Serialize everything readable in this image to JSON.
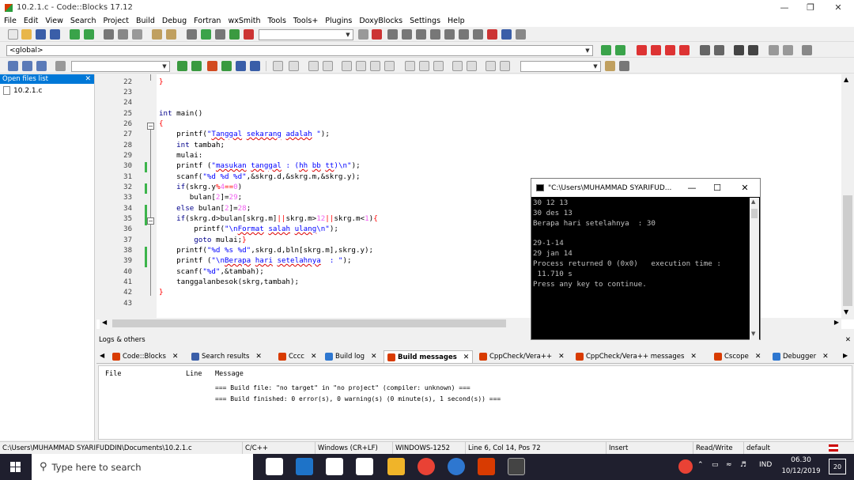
{
  "window": {
    "title": "10.2.1.c - Code::Blocks 17.12"
  },
  "menu": [
    "File",
    "Edit",
    "View",
    "Search",
    "Project",
    "Build",
    "Debug",
    "Fortran",
    "wxSmith",
    "Tools",
    "Tools+",
    "Plugins",
    "DoxyBlocks",
    "Settings",
    "Help"
  ],
  "toolbar": {
    "scope_combo": "<global>"
  },
  "open_files": {
    "header": "Open files list",
    "files": [
      "10.2.1.c"
    ]
  },
  "editor": {
    "line_numbers": [
      "22",
      "23",
      "24",
      "25",
      "26",
      "27",
      "28",
      "29",
      "30",
      "31",
      "32",
      "33",
      "34",
      "35",
      "36",
      "37",
      "38",
      "39",
      "40",
      "41",
      "42",
      "43"
    ],
    "lines": [
      "}",
      "",
      "",
      "int main()",
      "{",
      "    printf(\"Tanggal sekarang adalah \");",
      "    int tambah;",
      "    mulai:",
      "    printf (\"masukan tanggal : (hh bb tt)\\n\");",
      "    scanf(\"%d %d %d\",&skrg.d,&skrg.m,&skrg.y);",
      "    if(skrg.y%4==0)",
      "       bulan[2]=29;",
      "    else bulan[2]=28;",
      "    if(skrg.d>bulan[skrg.m]||skrg.m>12||skrg.m<1){",
      "        printf(\"\\nFormat salah ulang\\n\");",
      "        goto mulai;}",
      "    printf(\"%d %s %d\",skrg.d,bln[skrg.m],skrg.y);",
      "    printf (\"\\nBerapa hari setelahnya  : \");",
      "    scanf(\"%d\",&tambah);",
      "    tanggalanbesok(skrg,tambah);",
      "}",
      ""
    ]
  },
  "console": {
    "title": "\"C:\\Users\\MUHAMMAD SYARIFUD...",
    "lines": [
      "30 12 13",
      "30 des 13",
      "Berapa hari setelahnya  : 30",
      "",
      "29-1-14",
      "29 jan 14",
      "Process returned 0 (0x0)   execution time :",
      " 11.710 s",
      "Press any key to continue."
    ]
  },
  "logs": {
    "header": "Logs & others",
    "tabs": [
      "Code::Blocks",
      "Search results",
      "Cccc",
      "Build log",
      "Build messages",
      "CppCheck/Vera++",
      "CppCheck/Vera++ messages",
      "Cscope",
      "Debugger"
    ],
    "columns": [
      "File",
      "Line",
      "Message"
    ],
    "messages": [
      "=== Build file: \"no target\" in \"no project\" (compiler: unknown) ===",
      "=== Build finished: 0 error(s), 0 warning(s) (0 minute(s), 1 second(s)) ==="
    ]
  },
  "statusbar": {
    "path": "C:\\Users\\MUHAMMAD SYARIFUDDIN\\Documents\\10.2.1.c",
    "lang": "C/C++",
    "eol": "Windows (CR+LF)",
    "encoding": "WINDOWS-1252",
    "position": "Line 6, Col 14, Pos 72",
    "mode": "Insert",
    "rw": "Read/Write",
    "profile": "default"
  },
  "taskbar": {
    "search_placeholder": "Type here to search",
    "lang": "IND",
    "time": "06.30",
    "date": "10/12/2019",
    "notif_count": "20"
  }
}
